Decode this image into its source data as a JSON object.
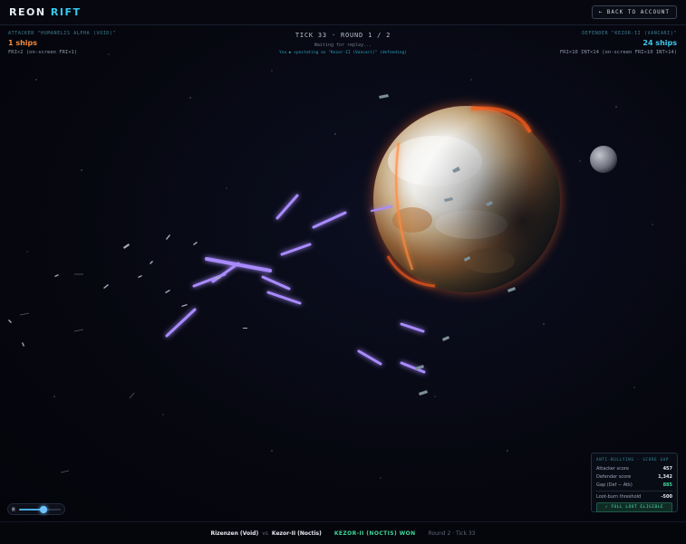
{
  "header": {
    "logo_part1": "REON",
    "logo_part2": "RIFT",
    "back_label": "← BACK TO ACCOUNT"
  },
  "attacker": {
    "label": "ATTACKER \"HUMANELIS ALPHA (VOID)\"",
    "ships": "1 ships",
    "fri": "FRI×2 (on-screen FRI×1)"
  },
  "defender": {
    "label": "DEFENDER \"KEZOR-II (VANCARI)\"",
    "ships": "24 ships",
    "fri": "FRI×10 INT×14 (on-screen FRI×10 INT×14)"
  },
  "status": {
    "tick": "TICK 33 · ROUND 1 / 2",
    "waiting": "Waiting for replay...",
    "spectating": "You ▶ spectating as \"Kezor-II (Vancari)\" (defending)"
  },
  "score_panel": {
    "title": "ANTI-BULLYING · SCORE GAP",
    "attacker_label": "Attacker score",
    "attacker_value": "457",
    "defender_label": "Defender score",
    "defender_value": "1,342",
    "gap_label": "Gap (Def − Atk)",
    "gap_value": "885",
    "threshold_label": "Loot-burn threshold",
    "threshold_value": "-500",
    "eligible_label": "✓ FULL LOOT ELIGIBLE"
  },
  "playback": {
    "icon": "camera-icon",
    "progress": 0.6
  },
  "footer": {
    "attacker_name": "Rizenzen (Void)",
    "vs": "vs",
    "defender_name": "Kezor-II (Noctis)",
    "result": "KEZOR-II (NOCTIS) WON",
    "round_tick": "Round 2 · Tick 33"
  },
  "colors": {
    "accent_cyan": "#35c9ee",
    "attacker_orange": "#f08a3c",
    "laser_violet": "#9b7bff",
    "win_green": "#3fd69a"
  }
}
